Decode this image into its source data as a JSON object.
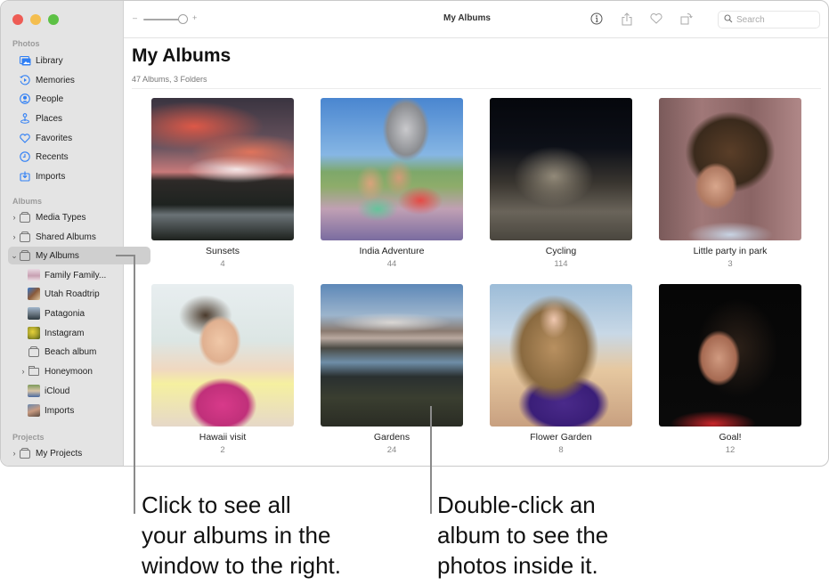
{
  "window": {
    "title": "My Albums",
    "search_placeholder": "Search",
    "zoom_minus": "–",
    "zoom_plus": "+",
    "zoom_level": 0.85
  },
  "sidebar": {
    "sections": [
      {
        "label": "Photos",
        "items": [
          {
            "label": "Library",
            "icon": "library-icon"
          },
          {
            "label": "Memories",
            "icon": "memories-icon"
          },
          {
            "label": "People",
            "icon": "people-icon"
          },
          {
            "label": "Places",
            "icon": "places-icon"
          },
          {
            "label": "Favorites",
            "icon": "heart-icon"
          },
          {
            "label": "Recents",
            "icon": "clock-icon"
          },
          {
            "label": "Imports",
            "icon": "import-icon"
          }
        ]
      },
      {
        "label": "Albums",
        "items": [
          {
            "label": "Media Types",
            "icon": "album-stack-icon",
            "expanded": false
          },
          {
            "label": "Shared Albums",
            "icon": "shared-album-icon",
            "expanded": false
          },
          {
            "label": "My Albums",
            "icon": "album-stack-icon",
            "expanded": true,
            "selected": true,
            "children": [
              {
                "label": "Family Family...",
                "icon": "thumbnail"
              },
              {
                "label": "Utah Roadtrip",
                "icon": "thumbnail"
              },
              {
                "label": "Patagonia",
                "icon": "thumbnail"
              },
              {
                "label": "Instagram",
                "icon": "thumbnail"
              },
              {
                "label": "Beach album",
                "icon": "album-stack-icon"
              },
              {
                "label": "Honeymoon",
                "icon": "folder-icon",
                "expanded": false
              },
              {
                "label": "iCloud",
                "icon": "thumbnail"
              },
              {
                "label": "Imports",
                "icon": "thumbnail"
              }
            ]
          }
        ]
      },
      {
        "label": "Projects",
        "items": [
          {
            "label": "My Projects",
            "icon": "album-stack-icon",
            "expanded": false
          }
        ]
      }
    ]
  },
  "main": {
    "title": "My Albums",
    "subtitle": "47 Albums, 3 Folders",
    "albums": [
      {
        "name": "Sunsets",
        "count": "4"
      },
      {
        "name": "India Adventure",
        "count": "44"
      },
      {
        "name": "Cycling",
        "count": "114"
      },
      {
        "name": "Little party in park",
        "count": "3"
      },
      {
        "name": "Hawaii visit",
        "count": "2"
      },
      {
        "name": "Gardens",
        "count": "24"
      },
      {
        "name": "Flower Garden",
        "count": "8"
      },
      {
        "name": "Goal!",
        "count": "12"
      }
    ]
  },
  "callouts": [
    {
      "text": "Click to see all\nyour albums in the\nwindow to the right."
    },
    {
      "text": "Double-click an\nalbum to see the\nphotos inside it."
    }
  ],
  "colors": {
    "accent": "#2f7ff5",
    "sidebar_bg": "#e4e4e4",
    "selected_bg": "#cfcfcf"
  }
}
